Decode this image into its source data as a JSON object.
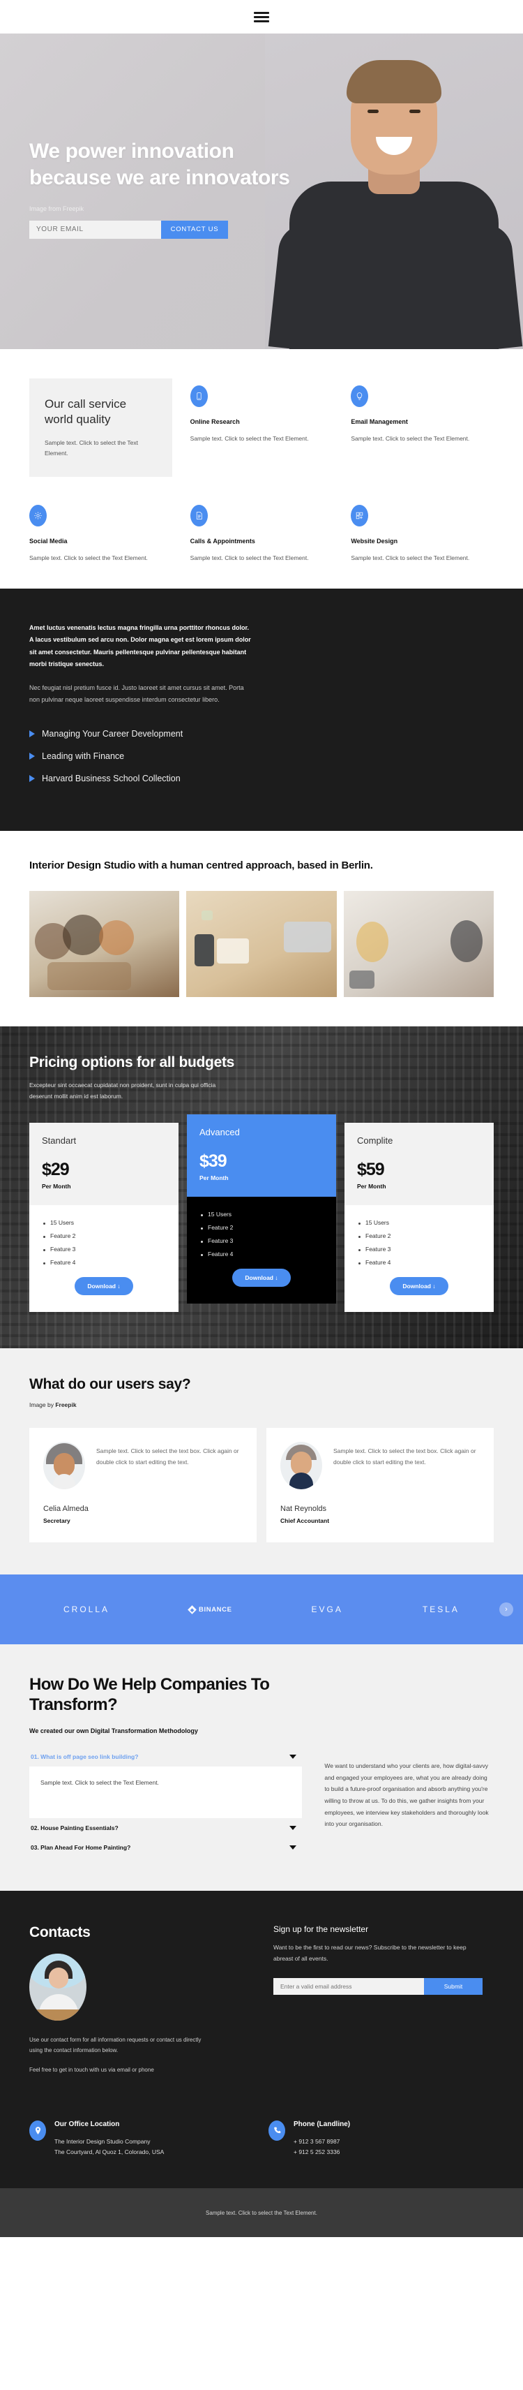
{
  "nav": {
    "menu_icon": "hamburger-menu-icon"
  },
  "hero": {
    "title": "We power innovation because we are innovators",
    "credit": "Image from Freepik",
    "email_placeholder": "YOUR EMAIL",
    "email_value": "",
    "cta_label": "CONTACT US"
  },
  "services": {
    "feature_card": {
      "title": "Our call service world quality",
      "body": "Sample text. Click to select the Text Element."
    },
    "items": [
      {
        "icon": "mobile-phone-icon",
        "title": "Online Research",
        "body": "Sample text. Click to select the Text Element."
      },
      {
        "icon": "lightbulb-icon",
        "title": "Email Management",
        "body": "Sample text. Click to select the Text Element."
      },
      {
        "icon": "gear-icon",
        "title": "Social Media",
        "body": "Sample text. Click to select the Text Element."
      },
      {
        "icon": "checklist-document-icon",
        "title": "Calls & Appointments",
        "body": "Sample text. Click to select the Text Element."
      },
      {
        "icon": "layout-grid-plus-icon",
        "title": "Website Design",
        "body": "Sample text. Click to select the Text Element."
      }
    ]
  },
  "dark_block": {
    "lead": "Amet luctus venenatis lectus magna fringilla urna porttitor rhoncus dolor. A lacus vestibulum sed arcu non. Dolor magna eget est lorem ipsum dolor sit amet consectetur. Mauris pellentesque pulvinar pellentesque habitant morbi tristique senectus.",
    "sub": "Nec feugiat nisl pretium fusce id. Justo laoreet sit amet cursus sit amet. Porta non pulvinar neque laoreet suspendisse interdum consectetur libero.",
    "links": [
      "Managing Your Career Development",
      "Leading with Finance",
      "Harvard Business School Collection"
    ]
  },
  "gallery": {
    "heading": "Interior Design Studio with a human centred approach, based in Berlin.",
    "images": [
      "team-meeting-photo",
      "desk-flatlay-photo",
      "office-conversation-photo"
    ]
  },
  "pricing": {
    "title": "Pricing options for all budgets",
    "subtitle": "Excepteur sint occaecat cupidatat non proident, sunt in culpa qui officia deserunt mollit anim id est laborum.",
    "per_month": "Per Month",
    "download_label": "Download ↓",
    "plans": [
      {
        "name": "Standart",
        "price": "$29",
        "features": [
          "15 Users",
          "Feature 2",
          "Feature 3",
          "Feature 4"
        ]
      },
      {
        "name": "Advanced",
        "price": "$39",
        "features": [
          "15 Users",
          "Feature 2",
          "Feature 3",
          "Feature 4"
        ]
      },
      {
        "name": "Complite",
        "price": "$59",
        "features": [
          "15 Users",
          "Feature 2",
          "Feature 3",
          "Feature 4"
        ]
      }
    ]
  },
  "testimonials": {
    "title": "What do our users say?",
    "credit_prefix": "Image by ",
    "credit_brand": "Freepik",
    "cards": [
      {
        "quote": "Sample text. Click to select the text box. Click again or double click to start editing the text.",
        "name": "Celia Almeda",
        "role": "Secretary"
      },
      {
        "quote": "Sample text. Click to select the text box. Click again or double click to start editing the text.",
        "name": "Nat Reynolds",
        "role": "Chief Accountant"
      }
    ]
  },
  "brands": {
    "items": [
      "CROLLA",
      "BINANCE",
      "EVGA",
      "TESLA"
    ],
    "next_arrow": "chevron-right-icon"
  },
  "faq": {
    "title": "How Do We Help Companies To Transform?",
    "subtitle": "We created our own Digital Transformation Methodology",
    "items": [
      {
        "q": "01. What is off page seo link building?",
        "a": "Sample text. Click to select the Text Element.",
        "open": true
      },
      {
        "q": "02. House Painting Essentials?",
        "a": "",
        "open": false
      },
      {
        "q": "03. Plan Ahead For Home Painting?",
        "a": "",
        "open": false
      }
    ],
    "side_text": "We want to understand who your clients are, how digital-savvy and engaged your employees are, what you are already doing to build a future-proof organisation and absorb anything you're willing to throw at us. To do this, we gather insights from your employees, we interview key stakeholders and thoroughly look into your organisation."
  },
  "contacts": {
    "title": "Contacts",
    "avatar": "woman-at-desk-photo",
    "text1": "Use our contact form for all information requests or contact us directly using the contact information below.",
    "text2": "Feel free to get in touch with us via email or phone",
    "office": {
      "icon": "map-pin-icon",
      "title": "Our Office Location",
      "line1": "The Interior Design Studio Company",
      "line2": "The Courtyard, Al Quoz 1, Colorado,  USA"
    },
    "phone": {
      "icon": "phone-icon",
      "title": "Phone (Landline)",
      "line1": "+ 912 3 567 8987",
      "line2": "+ 912 5 252 3336"
    },
    "newsletter": {
      "title": "Sign up for the newsletter",
      "body": "Want to be the first to read our news? Subscribe to the newsletter to keep abreast of all events.",
      "placeholder": "Enter a valid email address",
      "value": "",
      "submit_label": "Submit"
    }
  },
  "footer": {
    "text": "Sample text. Click to select the Text Element."
  },
  "colors": {
    "accent": "#4a8df0",
    "brand_band": "#5b8def",
    "dark": "#1c1c1c",
    "light": "#f1f1f1"
  }
}
